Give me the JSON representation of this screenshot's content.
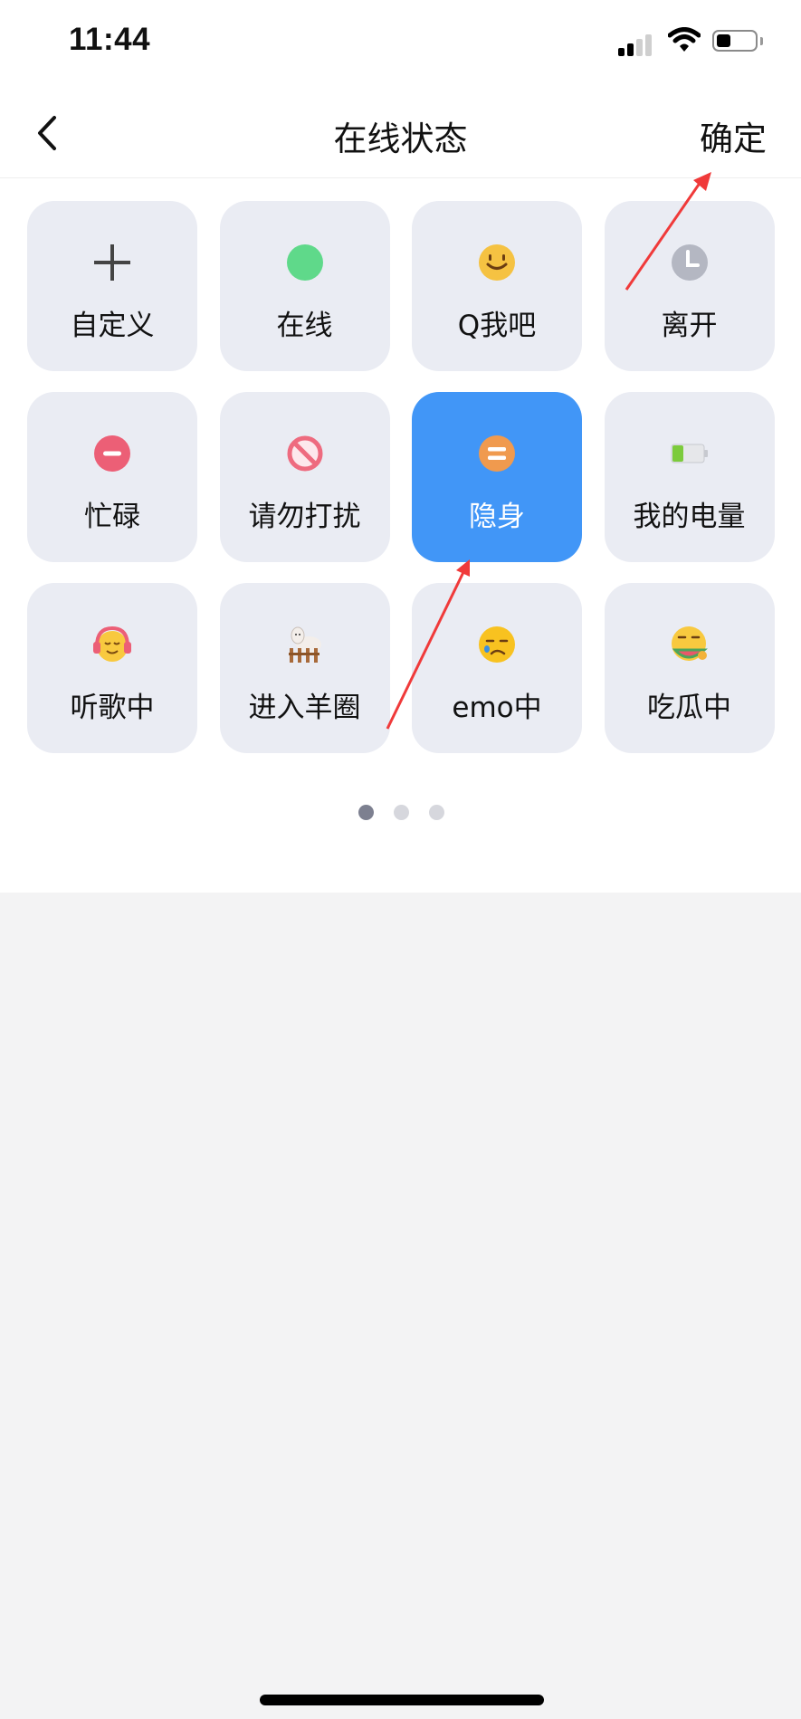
{
  "status_bar": {
    "time": "11:44",
    "signal_bars_active": 2,
    "signal_bars_total": 4,
    "battery_level": 0.35
  },
  "nav": {
    "back_icon": "chevron-left-icon",
    "title": "在线状态",
    "confirm_label": "确定"
  },
  "statuses": [
    {
      "label": "自定义",
      "icon": "plus-icon",
      "selected": false
    },
    {
      "label": "在线",
      "icon": "green-dot-icon",
      "selected": false
    },
    {
      "label": "Q我吧",
      "icon": "smile-face-icon",
      "selected": false
    },
    {
      "label": "离开",
      "icon": "clock-icon",
      "selected": false
    },
    {
      "label": "忙碌",
      "icon": "busy-minus-icon",
      "selected": false
    },
    {
      "label": "请勿打扰",
      "icon": "do-not-disturb-icon",
      "selected": false
    },
    {
      "label": "隐身",
      "icon": "invisible-equals-icon",
      "selected": true
    },
    {
      "label": "我的电量",
      "icon": "battery-icon",
      "selected": false
    },
    {
      "label": "听歌中",
      "icon": "headphones-face-icon",
      "selected": false
    },
    {
      "label": "进入羊圈",
      "icon": "alpaca-fence-icon",
      "selected": false
    },
    {
      "label": "emo中",
      "icon": "sad-tear-face-icon",
      "selected": false
    },
    {
      "label": "吃瓜中",
      "icon": "watermelon-face-icon",
      "selected": false
    }
  ],
  "pager": {
    "current_page": 1,
    "total_pages": 3
  },
  "colors": {
    "selected_tile": "#4196f7",
    "tile_bg": "#eaecf3",
    "online_green": "#5fd98a",
    "busy_red": "#ec5f76",
    "invisible_orange": "#f09a4e",
    "annotation_arrow": "#f03a3a"
  }
}
